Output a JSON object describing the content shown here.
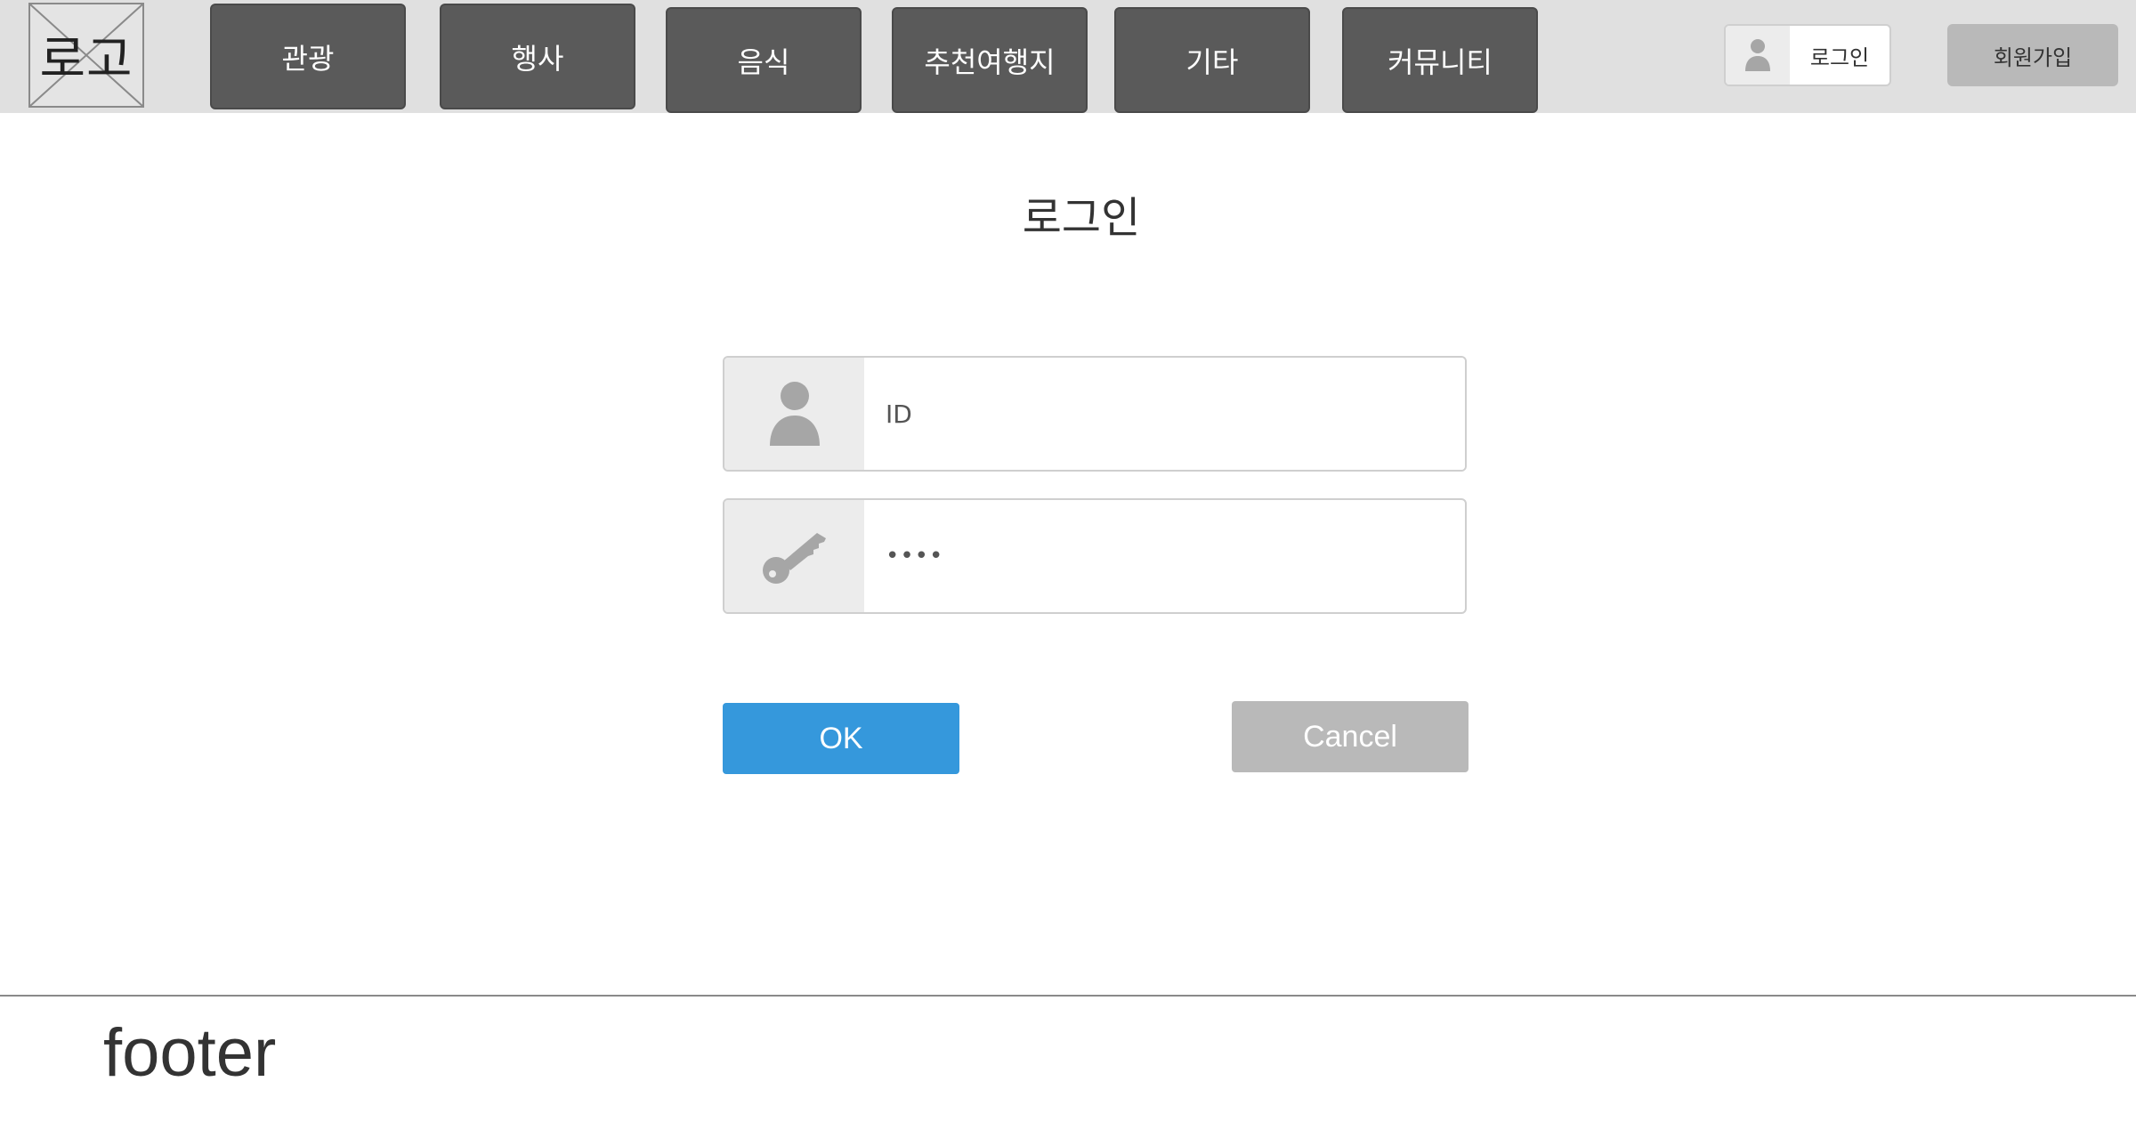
{
  "header": {
    "logo_text": "로고",
    "nav": [
      {
        "label": "관광"
      },
      {
        "label": "행사"
      },
      {
        "label": "음식"
      },
      {
        "label": "추천여행지"
      },
      {
        "label": "기타"
      },
      {
        "label": "커뮤니티"
      }
    ],
    "login_label": "로그인",
    "signup_label": "회원가입"
  },
  "main": {
    "title": "로그인",
    "id_field": {
      "placeholder": "ID",
      "icon": "user-icon"
    },
    "password_field": {
      "value_mask": "••••",
      "icon": "key-icon"
    },
    "ok_label": "OK",
    "cancel_label": "Cancel"
  },
  "footer": {
    "text": "footer"
  },
  "colors": {
    "header_bg": "#e0e0e0",
    "nav_bg": "#5a5a5a",
    "ok_bg": "#3598dc",
    "cancel_bg": "#b9b9b9"
  }
}
